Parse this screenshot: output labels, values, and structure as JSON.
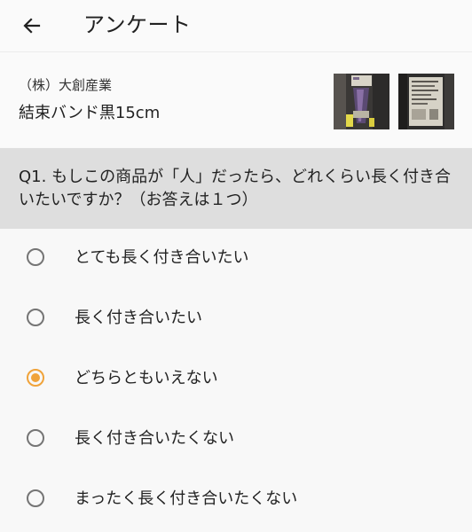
{
  "app_bar": {
    "title": "アンケート",
    "back_icon": "arrow-left-icon"
  },
  "product": {
    "maker": "（株）大創産業",
    "name": "結束バンド黒15cm"
  },
  "question": {
    "text": "Q1. もしこの商品が「人」だったら、どれくらい長く付き合いたいですか？（お答えは１つ）"
  },
  "options": [
    {
      "label": "とても長く付き合いたい",
      "selected": false
    },
    {
      "label": "長く付き合いたい",
      "selected": false
    },
    {
      "label": "どちらともいえない",
      "selected": true
    },
    {
      "label": "長く付き合いたくない",
      "selected": false
    },
    {
      "label": "まったく長く付き合いたくない",
      "selected": false
    }
  ],
  "colors": {
    "accent": "#f0a33a",
    "question_bg": "#dedede",
    "radio_unchecked": "#757575"
  }
}
